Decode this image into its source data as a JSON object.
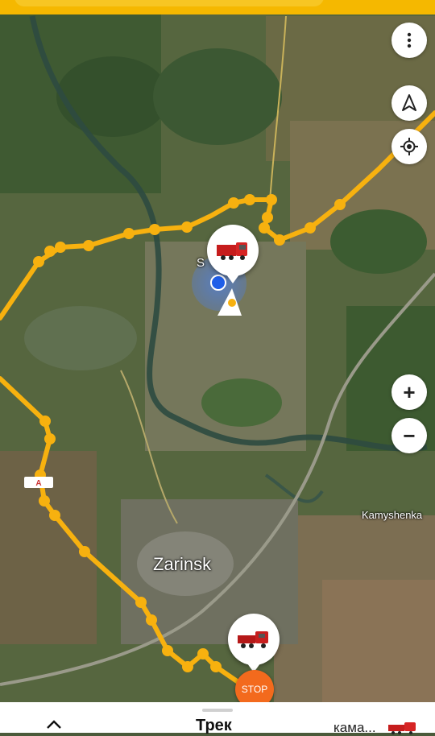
{
  "map": {
    "places": [
      {
        "id": "zarinsk",
        "label": "Zarinsk"
      },
      {
        "id": "kamyshenka",
        "label": "Kamyshenka"
      },
      {
        "id": "partial",
        "label": "S            o"
      }
    ],
    "road_badge": "A",
    "route_color": "#f7b10f"
  },
  "controls": {
    "menu_icon": "more-vert-icon",
    "compass_icon": "navigation-arrow-icon",
    "locate_icon": "my-location-icon",
    "zoom_in": "+",
    "zoom_out": "−"
  },
  "markers": {
    "stop_label": "STOP",
    "vehicle_icon": "red-truck-icon"
  },
  "bottom_bar": {
    "title": "Трек",
    "right_label": "кама..."
  }
}
